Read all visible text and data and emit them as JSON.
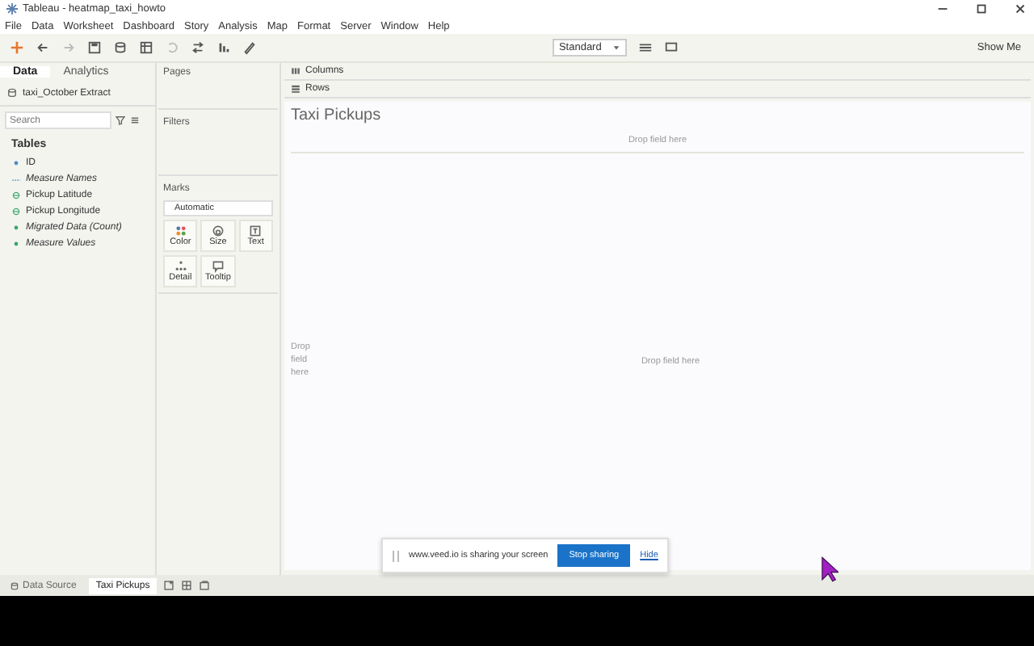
{
  "window": {
    "title": "Tableau - heatmap_taxi_howto"
  },
  "menu": [
    "File",
    "Data",
    "Worksheet",
    "Dashboard",
    "Story",
    "Analysis",
    "Map",
    "Format",
    "Server",
    "Window",
    "Help"
  ],
  "toolbar": {
    "fit": "Standard",
    "show_me": "Show Me"
  },
  "data_pane": {
    "tabs": [
      {
        "label": "Data",
        "selected": true
      },
      {
        "label": "Analytics",
        "selected": false
      }
    ],
    "datasource": "taxi_October Extract",
    "search": {
      "placeholder": "Search"
    },
    "section": "Tables",
    "fields": [
      {
        "name": "ID",
        "kind": "dimension",
        "italic": false
      },
      {
        "name": "Measure Names",
        "kind": "text",
        "italic": true
      },
      {
        "name": "Pickup Latitude",
        "kind": "geo",
        "italic": false
      },
      {
        "name": "Pickup Longitude",
        "kind": "geo",
        "italic": false
      },
      {
        "name": "Migrated Data (Count)",
        "kind": "measure",
        "italic": true
      },
      {
        "name": "Measure Values",
        "kind": "measure",
        "italic": true
      }
    ]
  },
  "cards": {
    "pages": "Pages",
    "filters": "Filters",
    "marks": "Marks",
    "mark_type": "Automatic",
    "mark_buttons": [
      {
        "label": "Color",
        "kind": "color"
      },
      {
        "label": "Size",
        "kind": "size"
      },
      {
        "label": "Text",
        "kind": "text"
      },
      {
        "label": "Detail",
        "kind": "detail"
      },
      {
        "label": "Tooltip",
        "kind": "tooltip"
      }
    ]
  },
  "shelves": [
    {
      "label": "Columns",
      "kind": "columns"
    },
    {
      "label": "Rows",
      "kind": "rows"
    }
  ],
  "view": {
    "title": "Taxi Pickups",
    "drop_top": "Drop field here",
    "drop_left": "Drop field here",
    "drop_center": "Drop field here"
  },
  "share_bar": {
    "message": "www.veed.io is sharing your screen",
    "stop": "Stop sharing",
    "hide": "Hide"
  },
  "sheet_tabs": [
    {
      "label": "Data Source",
      "kind": "datasource",
      "selected": false
    },
    {
      "label": "Taxi Pickups",
      "kind": "sheet",
      "selected": true
    }
  ]
}
